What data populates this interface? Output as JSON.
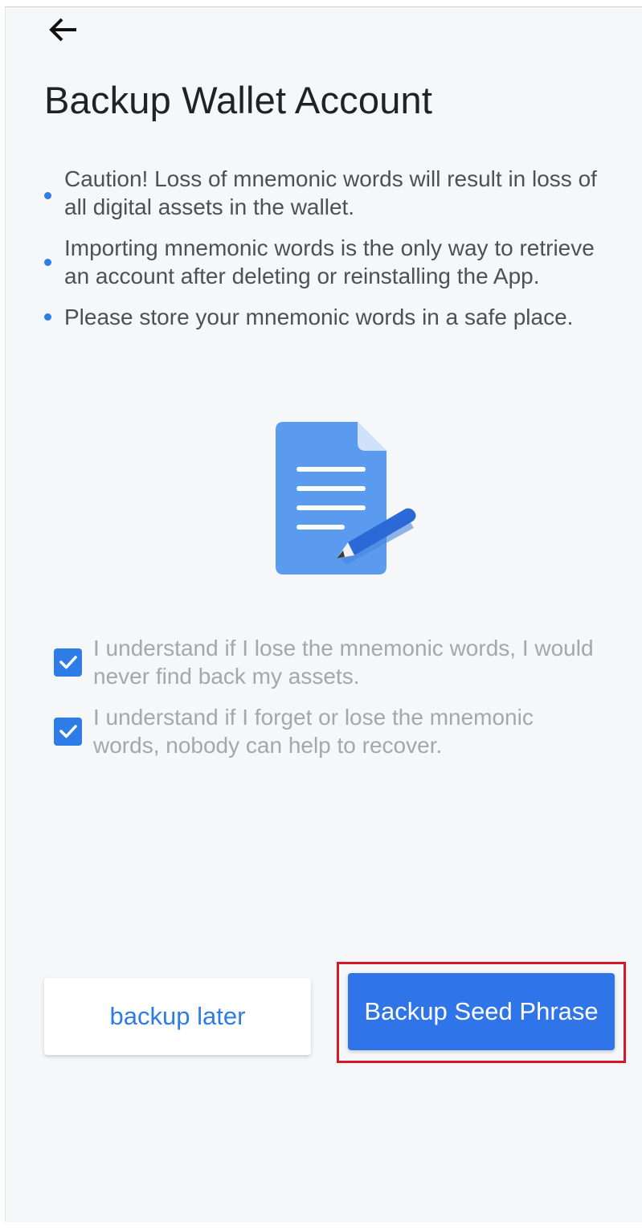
{
  "header": {
    "back_icon": "arrow-left-icon",
    "title": "Backup Wallet Account"
  },
  "notes": [
    {
      "text": "Caution! Loss of mnemonic words will result in loss of all digital assets in the wallet."
    },
    {
      "text": "Importing mnemonic words is the only way to retrieve an account after deleting or reinstalling the App."
    },
    {
      "text": "Please store your mnemonic words in a safe place."
    }
  ],
  "illustration": {
    "icon": "document-pen-icon"
  },
  "agreements": [
    {
      "checked": true,
      "text": "I understand if I lose the mnemonic words, I would never find back my assets."
    },
    {
      "checked": true,
      "text": "I understand if I forget or lose the mnemonic words, nobody can help to recover."
    }
  ],
  "actions": {
    "later_label": "backup later",
    "backup_label": "Backup Seed Phrase"
  },
  "colors": {
    "accent": "#2e7de6",
    "primary_button": "#2f74e9",
    "highlight": "#d4182a"
  }
}
